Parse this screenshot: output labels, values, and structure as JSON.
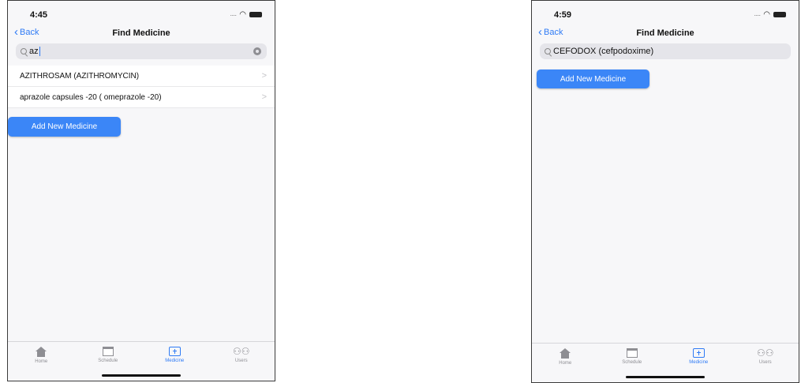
{
  "colors": {
    "accent": "#3b86f7",
    "background": "#f7f7f9",
    "search_field": "#e5e5ea"
  },
  "left_screen": {
    "status_time": "4:45",
    "nav": {
      "back_label": "Back",
      "title": "Find Medicine"
    },
    "search": {
      "value": "az"
    },
    "results": [
      {
        "label": "AZITHROSAM (AZITHROMYCIN)"
      },
      {
        "label": "aprazole capsules -20 ( omeprazole -20)"
      }
    ],
    "add_button_label": "Add New Medicine",
    "tabs": [
      {
        "label": "Home",
        "icon": "home-icon"
      },
      {
        "label": "Schedule",
        "icon": "calendar-icon"
      },
      {
        "label": "Medicine",
        "icon": "medical-box-icon",
        "active": true
      },
      {
        "label": "Users",
        "icon": "users-icon"
      }
    ]
  },
  "right_screen": {
    "status_time": "4:59",
    "nav": {
      "back_label": "Back",
      "title": "Find Medicine"
    },
    "search": {
      "value": "CEFODOX (cefpodoxime)"
    },
    "add_button_label": "Add New Medicine",
    "tabs": [
      {
        "label": "Home",
        "icon": "home-icon"
      },
      {
        "label": "Schedule",
        "icon": "calendar-icon"
      },
      {
        "label": "Medicine",
        "icon": "medical-box-icon",
        "active": true
      },
      {
        "label": "Users",
        "icon": "users-icon"
      }
    ]
  }
}
